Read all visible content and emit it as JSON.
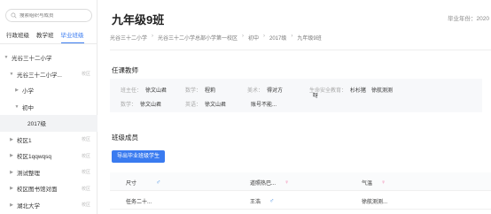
{
  "sidebar": {
    "search_placeholder": "搜索组织与成员",
    "tabs": [
      {
        "label": "行政班级",
        "active": false
      },
      {
        "label": "教学班",
        "active": false
      },
      {
        "label": "毕业班级",
        "active": true
      }
    ],
    "tree": [
      {
        "label": "光谷三十二小学",
        "arrow": "▼",
        "indent": 1,
        "tag": ""
      },
      {
        "label": "光谷三十二小学...",
        "arrow": "▼",
        "indent": 2,
        "tag": "校区"
      },
      {
        "label": "小学",
        "arrow": "▶",
        "indent": 3,
        "tag": ""
      },
      {
        "label": "初中",
        "arrow": "▼",
        "indent": 3,
        "tag": ""
      },
      {
        "label": "2017级",
        "arrow": "",
        "indent": 4,
        "tag": "",
        "selected": true
      },
      {
        "label": "校区1",
        "arrow": "▶",
        "indent": 2,
        "tag": "校区"
      },
      {
        "label": "校区1qqwqsq",
        "arrow": "▶",
        "indent": 2,
        "tag": "校区"
      },
      {
        "label": "测试整理",
        "arrow": "▶",
        "indent": 2,
        "tag": "校区"
      },
      {
        "label": "校区图书馆对面",
        "arrow": "▶",
        "indent": 2,
        "tag": "校区"
      },
      {
        "label": "湖北大学",
        "arrow": "▶",
        "indent": 2,
        "tag": "校区"
      }
    ]
  },
  "main": {
    "title": "九年级9班",
    "year": "毕业年份：2020",
    "breadcrumbs": [
      "光谷三十二小学",
      "光谷三十二小学总部小学第一校区",
      "初中",
      "2017级",
      "九年级9班"
    ],
    "teachers_title": "任课教师",
    "teachers": [
      {
        "label": "班主任：",
        "value": "徐文山君"
      },
      {
        "label": "数学：",
        "value": "程莉"
      },
      {
        "label": "美术：",
        "value": "得对方"
      },
      {
        "label": "生命安全教育：",
        "value": "杉杉猪　徐航测测"
      },
      {
        "label": "",
        "value": "呀"
      },
      {
        "label": "数学：",
        "value": "徐文山君"
      },
      {
        "label": "英语：",
        "value": "徐文山君"
      },
      {
        "label": "",
        "value": "账号不能..."
      }
    ],
    "members_title": "班级成员",
    "export_label": "导出毕业班级学生",
    "members": [
      [
        {
          "name": "尺寸",
          "gender": "male"
        },
        {
          "name": "道照热巴...",
          "gender": "female"
        },
        {
          "name": "气温",
          "gender": "female"
        }
      ],
      [
        {
          "name": "任务二十...",
          "gender": ""
        },
        {
          "name": "王浩",
          "gender": "male"
        },
        {
          "name": "徐航测测...",
          "gender": ""
        }
      ]
    ]
  },
  "colors": {
    "accent": "#3a7bf0",
    "male": "#4a90e2",
    "female": "#f07aa8"
  },
  "icons": {
    "male": "♂",
    "female": "♀"
  }
}
